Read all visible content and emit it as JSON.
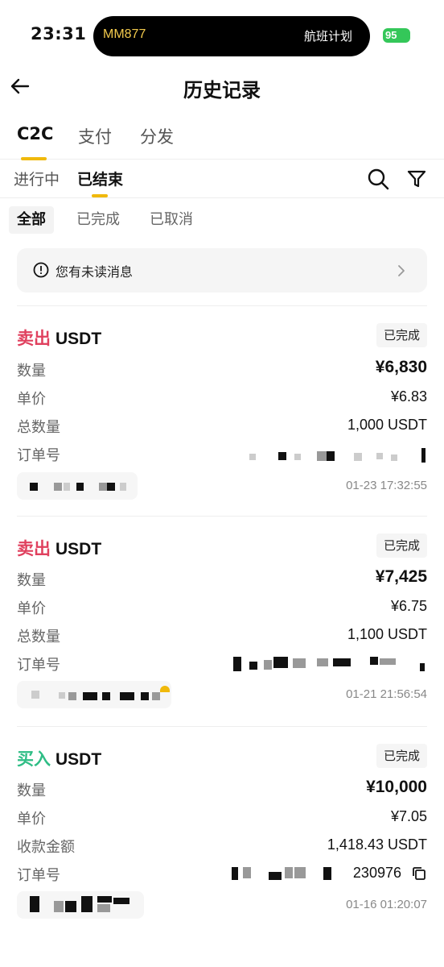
{
  "status_bar": {
    "time": "23:31",
    "island_left": "MM877",
    "island_right": "航班计划",
    "battery": "95"
  },
  "header": {
    "title": "历史记录",
    "back_icon": "arrow-left-icon"
  },
  "tabs": {
    "main": [
      "C2C",
      "支付",
      "分发"
    ],
    "active_main": "C2C",
    "sub": [
      "进行中",
      "已结束"
    ],
    "active_sub": "已结束"
  },
  "filters": [
    "全部",
    "已完成",
    "已取消"
  ],
  "active_filter": "全部",
  "notice": {
    "text": "您有未读消息",
    "icon": "info-circle-icon"
  },
  "colors": {
    "accent": "#f0b90b",
    "sell": "#e0405e",
    "buy": "#2ebd85"
  },
  "orders": [
    {
      "side": "卖出",
      "asset": "USDT",
      "status": "已完成",
      "rows": [
        {
          "label": "数量",
          "value": "¥6,830"
        },
        {
          "label": "单价",
          "value": "¥6.83"
        },
        {
          "label": "总数量",
          "value": "1,000 USDT"
        },
        {
          "label": "订单号",
          "value": ""
        }
      ],
      "time": "01-23 17:32:55"
    },
    {
      "side": "卖出",
      "asset": "USDT",
      "status": "已完成",
      "rows": [
        {
          "label": "数量",
          "value": "¥7,425"
        },
        {
          "label": "单价",
          "value": "¥6.75"
        },
        {
          "label": "总数量",
          "value": "1,100 USDT"
        },
        {
          "label": "订单号",
          "value": ""
        }
      ],
      "time": "01-21 21:56:54"
    },
    {
      "side": "买入",
      "asset": "USDT",
      "status": "已完成",
      "rows": [
        {
          "label": "数量",
          "value": "¥10,000"
        },
        {
          "label": "单价",
          "value": "¥7.05"
        },
        {
          "label": "收款金额",
          "value": "1,418.43 USDT"
        },
        {
          "label": "订单号",
          "value": "230976"
        }
      ],
      "time": "01-16 01:20:07"
    }
  ]
}
